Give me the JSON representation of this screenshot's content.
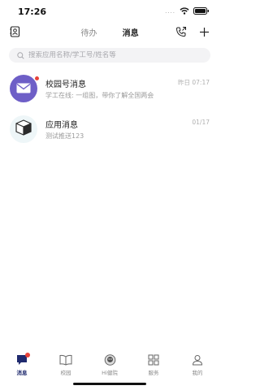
{
  "status_bar": {
    "time": "17:26",
    "signal": "....",
    "wifi_icon": "wifi-icon",
    "battery_icon": "battery-icon"
  },
  "top_nav": {
    "contacts_icon": "contacts-icon",
    "tabs": [
      {
        "label": "待办",
        "active": false
      },
      {
        "label": "消息",
        "active": true
      }
    ],
    "phone_icon": "phone-icon",
    "add_icon": "plus-icon"
  },
  "search": {
    "placeholder": "搜索应用名称/学工号/姓名等",
    "value": ""
  },
  "messages": [
    {
      "title": "校园号消息",
      "subtitle": "学工在线: 一组图，带你了解全国两会",
      "time": "昨日 07:17",
      "icon": "mail-icon",
      "unread": true
    },
    {
      "title": "应用消息",
      "subtitle": "测试推送123",
      "time": "01/17",
      "icon": "box-icon",
      "unread": false
    }
  ],
  "tabbar": [
    {
      "label": "消息",
      "icon": "message-icon",
      "active": true,
      "dot": true
    },
    {
      "label": "校园",
      "icon": "book-icon",
      "active": false,
      "dot": false
    },
    {
      "label": "Hi健院",
      "icon": "mascot-icon",
      "active": false,
      "dot": false
    },
    {
      "label": "服务",
      "icon": "grid-icon",
      "active": false,
      "dot": false
    },
    {
      "label": "我的",
      "icon": "person-icon",
      "active": false,
      "dot": false
    }
  ],
  "colors": {
    "accent": "#1f2a6e",
    "badge": "#e8433a",
    "avatar_purple": "#6e5fc7"
  }
}
